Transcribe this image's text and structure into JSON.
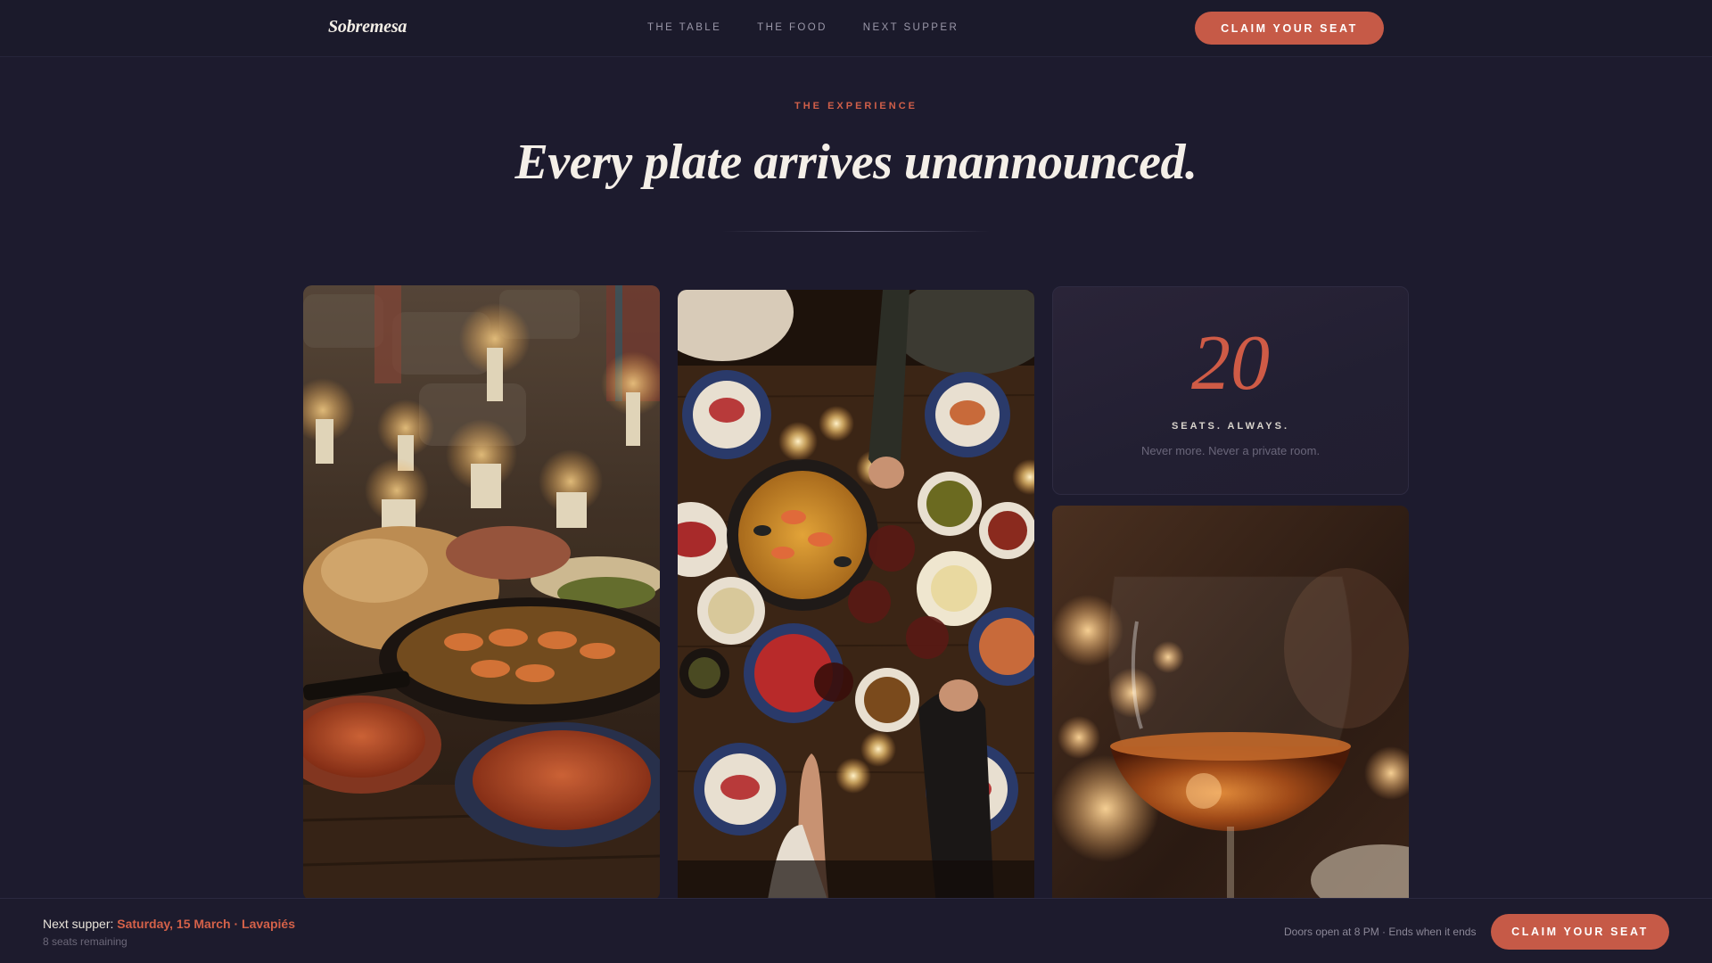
{
  "nav": {
    "brand": "Sobremesa",
    "links": [
      "THE TABLE",
      "THE FOOD",
      "NEXT SUPPER"
    ],
    "cta_label": "CLAIM YOUR SEAT"
  },
  "hero": {
    "eyebrow": "THE EXPERIENCE",
    "headline": "Every plate arrives unannounced."
  },
  "stat": {
    "number": "20",
    "label": "SEATS. ALWAYS.",
    "sub": "Never more. Never a private room."
  },
  "sticky": {
    "prefix": "Next supper: ",
    "highlight": "Saturday, 15 March · Lavapiés",
    "seats": "8 seats remaining",
    "note": "Doors open at 8 PM · Ends when it ends",
    "cta_label": "CLAIM YOUR SEAT"
  },
  "colors": {
    "background": "#1d1b2e",
    "accent": "#c65a47",
    "text": "#e9e4dc"
  }
}
